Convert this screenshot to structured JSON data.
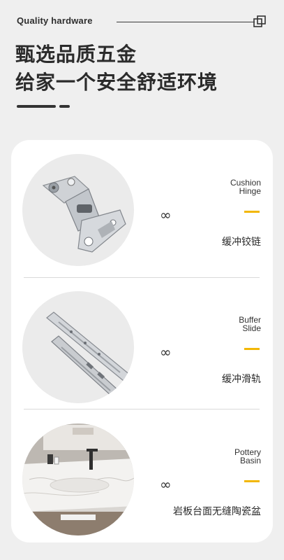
{
  "header": {
    "brand": "Quality hardware",
    "headline_line1": "甄选品质五金",
    "headline_line2": "给家一个安全舒适环境"
  },
  "colors": {
    "accent": "#f2b705",
    "text": "#2b2b2b",
    "background": "#efefef",
    "card": "#ffffff"
  },
  "icons": {
    "header": "copy-icon",
    "connector": "infinity-icon"
  },
  "products": [
    {
      "en_line1": "Cushion",
      "en_line2": "Hinge",
      "cn": "缓冲铰链",
      "connector": "∞"
    },
    {
      "en_line1": "Buffer",
      "en_line2": "Slide",
      "cn": "缓冲滑轨",
      "connector": "∞"
    },
    {
      "en_line1": "Pottery",
      "en_line2": "Basin",
      "cn": "岩板台面无缝陶瓷盆",
      "connector": "∞"
    }
  ]
}
